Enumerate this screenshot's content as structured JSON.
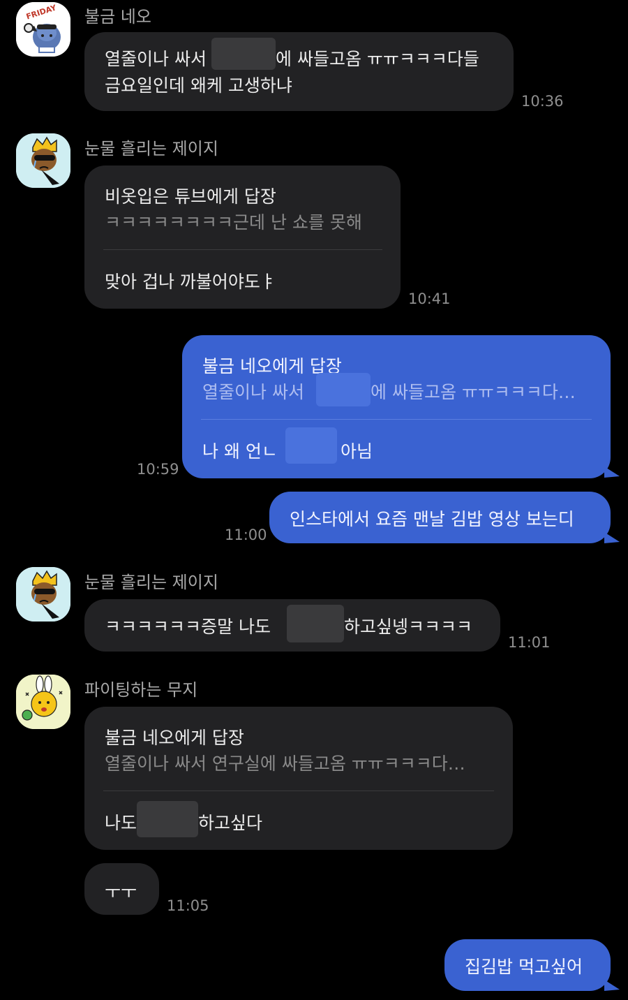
{
  "messages": {
    "m1": {
      "sender": "불금 네오",
      "line1_a": "열줄이나 싸서",
      "line1_b": "에 싸들고옴 ㅠㅠㅋㅋㅋ다들",
      "line2": "금요일인데 왜케 고생하냐",
      "time": "10:36"
    },
    "m2": {
      "sender": "눈물 흘리는 제이지",
      "reply_title": "비옷입은 튜브에게 답장",
      "reply_preview": "ㅋㅋㅋㅋㅋㅋㅋㅋ근데 난 쇼를 못해",
      "text": "맞아 겁나 까불어야도ㅑ",
      "time": "10:41"
    },
    "m3": {
      "reply_title": "불금 네오에게 답장",
      "reply_preview_a": "열줄이나 싸서",
      "reply_preview_b": "에 싸들고옴 ㅠㅠㅋㅋㅋ다…",
      "text_a": "나 왜 언ㄴ",
      "text_b": "아님",
      "time": "10:59"
    },
    "m4": {
      "text": "인스타에서 요즘 맨날 김밥 영상 보는디",
      "time": "11:00"
    },
    "m5": {
      "sender": "눈물 흘리는 제이지",
      "text_a": "ㅋㅋㅋㅋㅋㅋ증말 나도",
      "text_b": "하고싶넹ㅋㅋㅋㅋ",
      "time": "11:01"
    },
    "m6": {
      "sender": "파이팅하는 무지",
      "reply_title": "불금 네오에게 답장",
      "reply_preview": "열줄이나 싸서 연구실에 싸들고옴 ㅠㅠㅋㅋㅋ다…",
      "text_a": "나도",
      "text_b": "하고싶다"
    },
    "m7": {
      "text": "ㅜㅜ",
      "time": "11:05"
    },
    "m8": {
      "text": "집김밥 먹고싶어"
    }
  },
  "avatars": {
    "neo": {
      "icon": "neo-friday-icon",
      "badge": "FRIDAY"
    },
    "jayg": {
      "icon": "jayg-crying-icon"
    },
    "muzi": {
      "icon": "muzi-fighting-icon"
    }
  },
  "colors": {
    "background": "#000000",
    "incoming_bubble": "#222224",
    "outgoing_bubble": "#3a62d1"
  }
}
